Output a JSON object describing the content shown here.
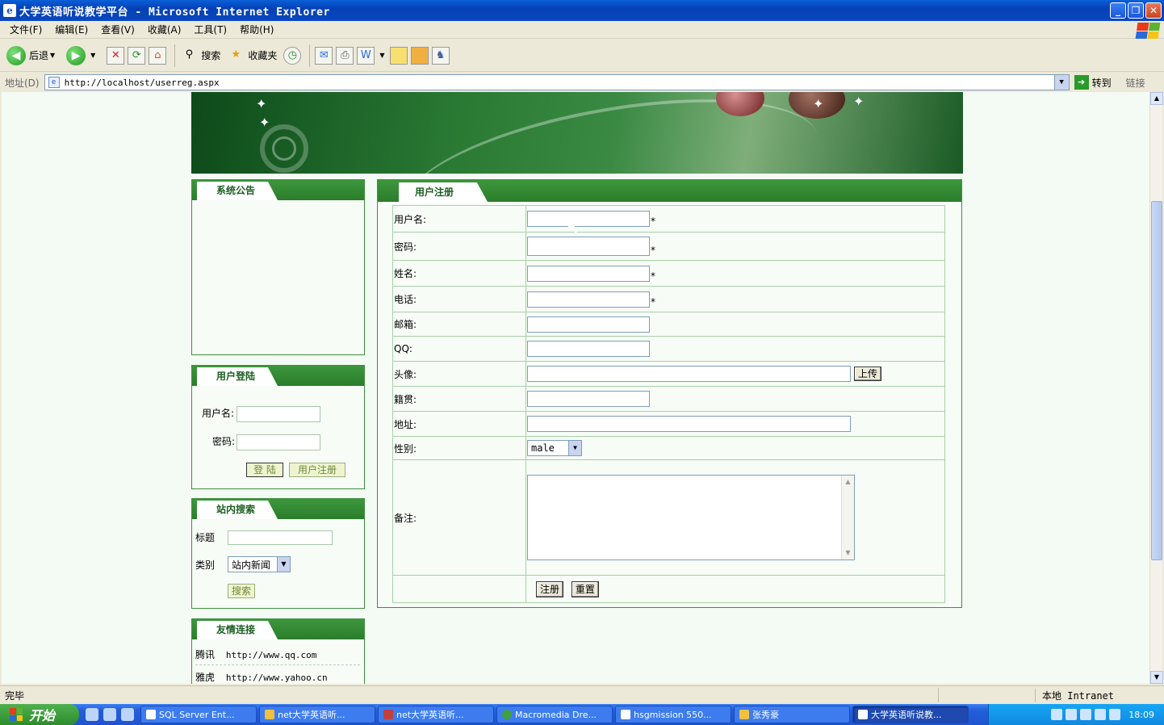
{
  "window": {
    "title": "大学英语听说教学平台 - Microsoft Internet Explorer"
  },
  "menu": [
    "文件(F)",
    "编辑(E)",
    "查看(V)",
    "收藏(A)",
    "工具(T)",
    "帮助(H)"
  ],
  "toolbar": {
    "back": "后退",
    "search": "搜索",
    "favorites": "收藏夹"
  },
  "address": {
    "label": "地址(D)",
    "url": "http://localhost/userreg.aspx",
    "go": "转到",
    "links": "链接"
  },
  "sidebar": {
    "notice": {
      "title": "系统公告"
    },
    "login": {
      "title": "用户登陆",
      "user_label": "用户名:",
      "pass_label": "密码:",
      "login_btn": "登 陆",
      "register_btn": "用户注册"
    },
    "search": {
      "title": "站内搜索",
      "title_label": "标题",
      "type_label": "类别",
      "type_value": "站内新闻",
      "search_btn": "搜索"
    },
    "links": {
      "title": "友情连接",
      "items": [
        {
          "name": "腾讯",
          "url": "http://www.qq.com"
        },
        {
          "name": "雅虎",
          "url": "http://www.yahoo.cn"
        }
      ]
    }
  },
  "register": {
    "title": "用户注册",
    "fields": {
      "username": "用户名:",
      "password": "密码:",
      "realname": "姓名:",
      "phone": "电话:",
      "email": "邮箱:",
      "qq": "QQ:",
      "avatar": "头像:",
      "hometown": "籍贯:",
      "address": "地址:",
      "gender": "性别:",
      "remark": "备注:"
    },
    "required_mark": "*",
    "upload_btn": "上传",
    "gender_value": "male",
    "submit_btn": "注册",
    "reset_btn": "重置"
  },
  "status": {
    "text": "完毕",
    "zone": "本地 Intranet"
  },
  "taskbar": {
    "start": "开始",
    "tasks": [
      "SQL Server Ent...",
      "net大学英语听...",
      "net大学英语听...",
      "Macromedia Dre...",
      "hsgmission 550...",
      "张秀豪",
      "大学英语听说教..."
    ],
    "clock": "18:09"
  }
}
